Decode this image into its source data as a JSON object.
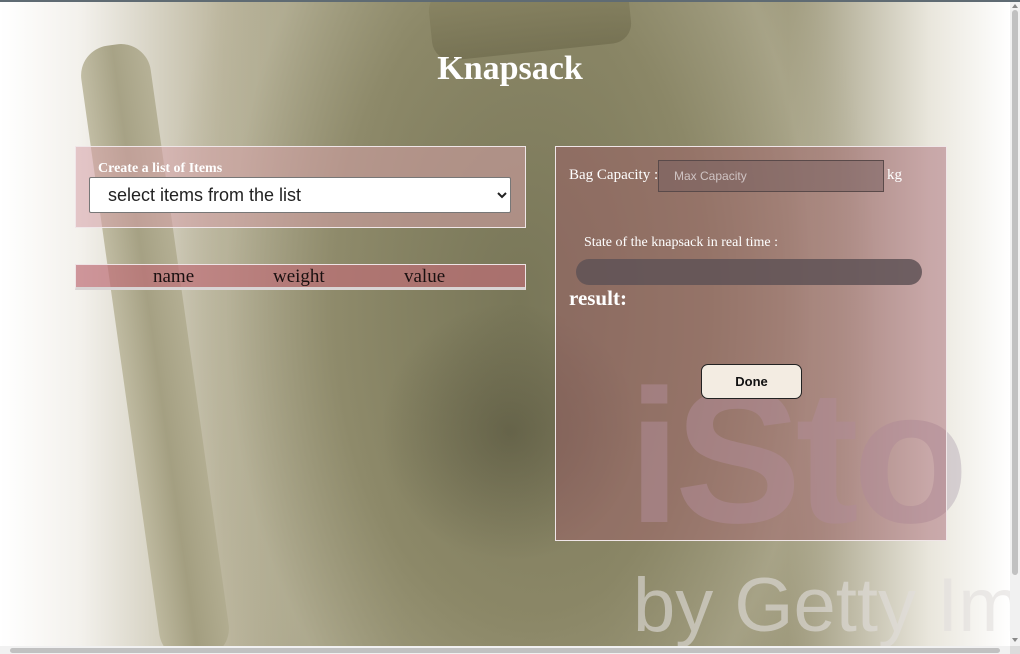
{
  "page": {
    "title": "Knapsack"
  },
  "watermark": {
    "line1": "iSto",
    "line2": "by Getty Im"
  },
  "items_panel": {
    "legend": "Create a list of Items",
    "select_value": "select items from the list"
  },
  "items_table": {
    "columns": [
      "name",
      "weight",
      "value"
    ]
  },
  "bag_panel": {
    "capacity_label": "Bag Capacity :",
    "capacity_placeholder": "Max Capacity",
    "capacity_unit": "kg",
    "state_label": "State of the knapsack in real time :",
    "progress_fraction": 0,
    "result_label": "result:",
    "done_label": "Done"
  }
}
